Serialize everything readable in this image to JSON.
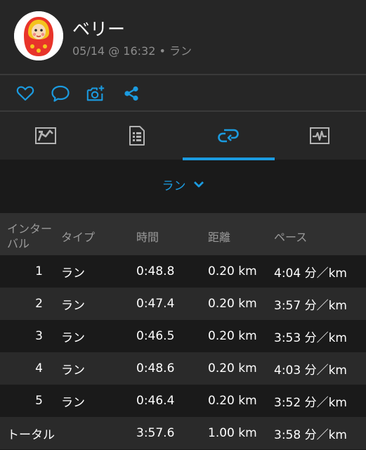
{
  "header": {
    "user_name": "ベリー",
    "meta": "05/14 @ 16:32 • ラン"
  },
  "actions": [
    {
      "name": "like-button",
      "icon": "heart-icon"
    },
    {
      "name": "comment-button",
      "icon": "comment-icon"
    },
    {
      "name": "add-photo-button",
      "icon": "camera-plus-icon"
    },
    {
      "name": "share-button",
      "icon": "share-icon"
    }
  ],
  "tabs": [
    {
      "name": "tab-map",
      "icon": "map-icon",
      "active": false
    },
    {
      "name": "tab-details",
      "icon": "document-icon",
      "active": false
    },
    {
      "name": "tab-laps",
      "icon": "laps-icon",
      "active": true
    },
    {
      "name": "tab-charts",
      "icon": "chart-icon",
      "active": false
    }
  ],
  "filter": {
    "selected": "ラン"
  },
  "table": {
    "headers": {
      "interval_line1": "インター",
      "interval_line2": "バル",
      "type": "タイプ",
      "time": "時間",
      "distance": "距離",
      "pace": "ペース"
    },
    "rows": [
      {
        "idx": "1",
        "type": "ラン",
        "time": "0:48.8",
        "distance": "0.20 km",
        "pace": "4:04 分／km"
      },
      {
        "idx": "2",
        "type": "ラン",
        "time": "0:47.4",
        "distance": "0.20 km",
        "pace": "3:57 分／km"
      },
      {
        "idx": "3",
        "type": "ラン",
        "time": "0:46.5",
        "distance": "0.20 km",
        "pace": "3:53 分／km"
      },
      {
        "idx": "4",
        "type": "ラン",
        "time": "0:48.6",
        "distance": "0.20 km",
        "pace": "4:03 分／km"
      },
      {
        "idx": "5",
        "type": "ラン",
        "time": "0:46.4",
        "distance": "0.20 km",
        "pace": "3:52 分／km"
      }
    ],
    "total": {
      "label": "トータル",
      "time": "3:57.6",
      "distance": "1.00 km",
      "pace": "3:58 分／km"
    }
  },
  "colors": {
    "accent": "#1b9be0",
    "background": "#1a1a1a",
    "header_bg": "#262626"
  }
}
